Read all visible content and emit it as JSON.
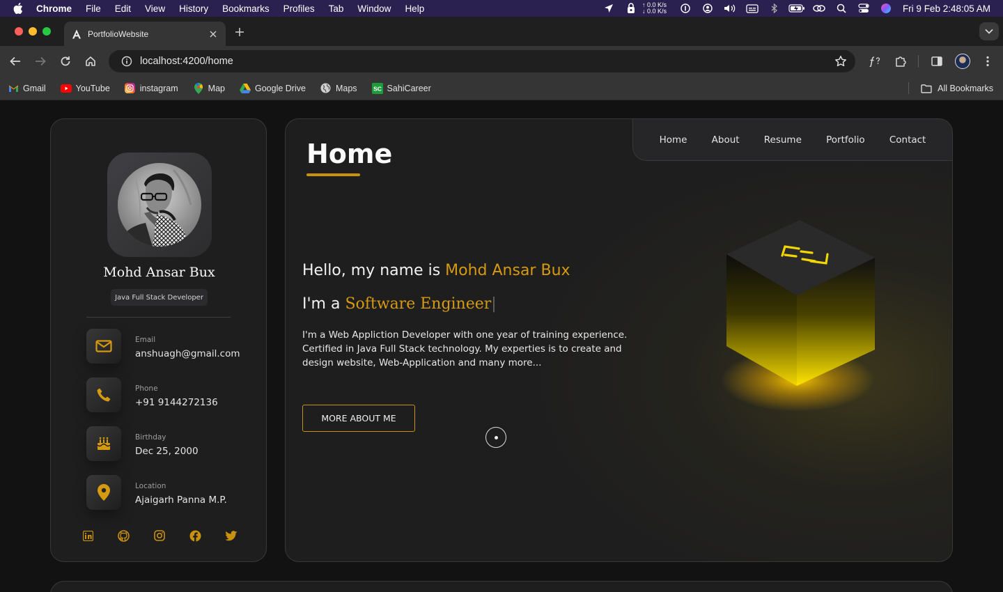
{
  "menubar": {
    "app": "Chrome",
    "items": [
      "File",
      "Edit",
      "View",
      "History",
      "Bookmarks",
      "Profiles",
      "Tab",
      "Window",
      "Help"
    ],
    "net_up": "↑ 0.0 K/s",
    "net_down": "↓ 0.0 K/s",
    "clock": "Fri 9 Feb  2:48:05 AM"
  },
  "tab": {
    "title": "PortfolioWebsite"
  },
  "toolbar": {
    "url": "localhost:4200/home"
  },
  "bookmarks": {
    "items": [
      "Gmail",
      "YouTube",
      "instagram",
      "Map",
      "Google Drive",
      "Maps",
      "SahiCareer"
    ],
    "all": "All Bookmarks"
  },
  "sidebar": {
    "name": "Mohd Ansar Bux",
    "title": "Java Full Stack Developer",
    "contacts": [
      {
        "label": "Email",
        "value": "anshuagh@gmail.com",
        "icon": "envelope-icon"
      },
      {
        "label": "Phone",
        "value": "+91 9144272136",
        "icon": "phone-icon"
      },
      {
        "label": "Birthday",
        "value": "Dec 25, 2000",
        "icon": "birthday-cake-icon"
      },
      {
        "label": "Location",
        "value": "Ajaigarh Panna M.P.",
        "icon": "location-pin-icon"
      }
    ],
    "socials": [
      "linkedin-icon",
      "github-icon",
      "instagram-icon",
      "facebook-icon",
      "twitter-icon"
    ]
  },
  "main": {
    "title": "Home",
    "nav": [
      "Home",
      "About",
      "Resume",
      "Portfolio",
      "Contact"
    ],
    "hello_prefix": "Hello, my name is ",
    "hello_name": "Mohd Ansar Bux",
    "role_prefix": "I'm a ",
    "role_text": "Software Engineer",
    "role_cursor": "|",
    "bio": "I'm a Web Appliction Developer with one year of training experience. Certified in Java Full Stack technology. My experties is to create and design website, Web-Application and many more...",
    "cta": "MORE ABOUT ME"
  },
  "colors": {
    "accent": "#c9910d",
    "accent_text": "#d59a10",
    "panel": "#1e1e1f",
    "page_bg": "#121212"
  }
}
